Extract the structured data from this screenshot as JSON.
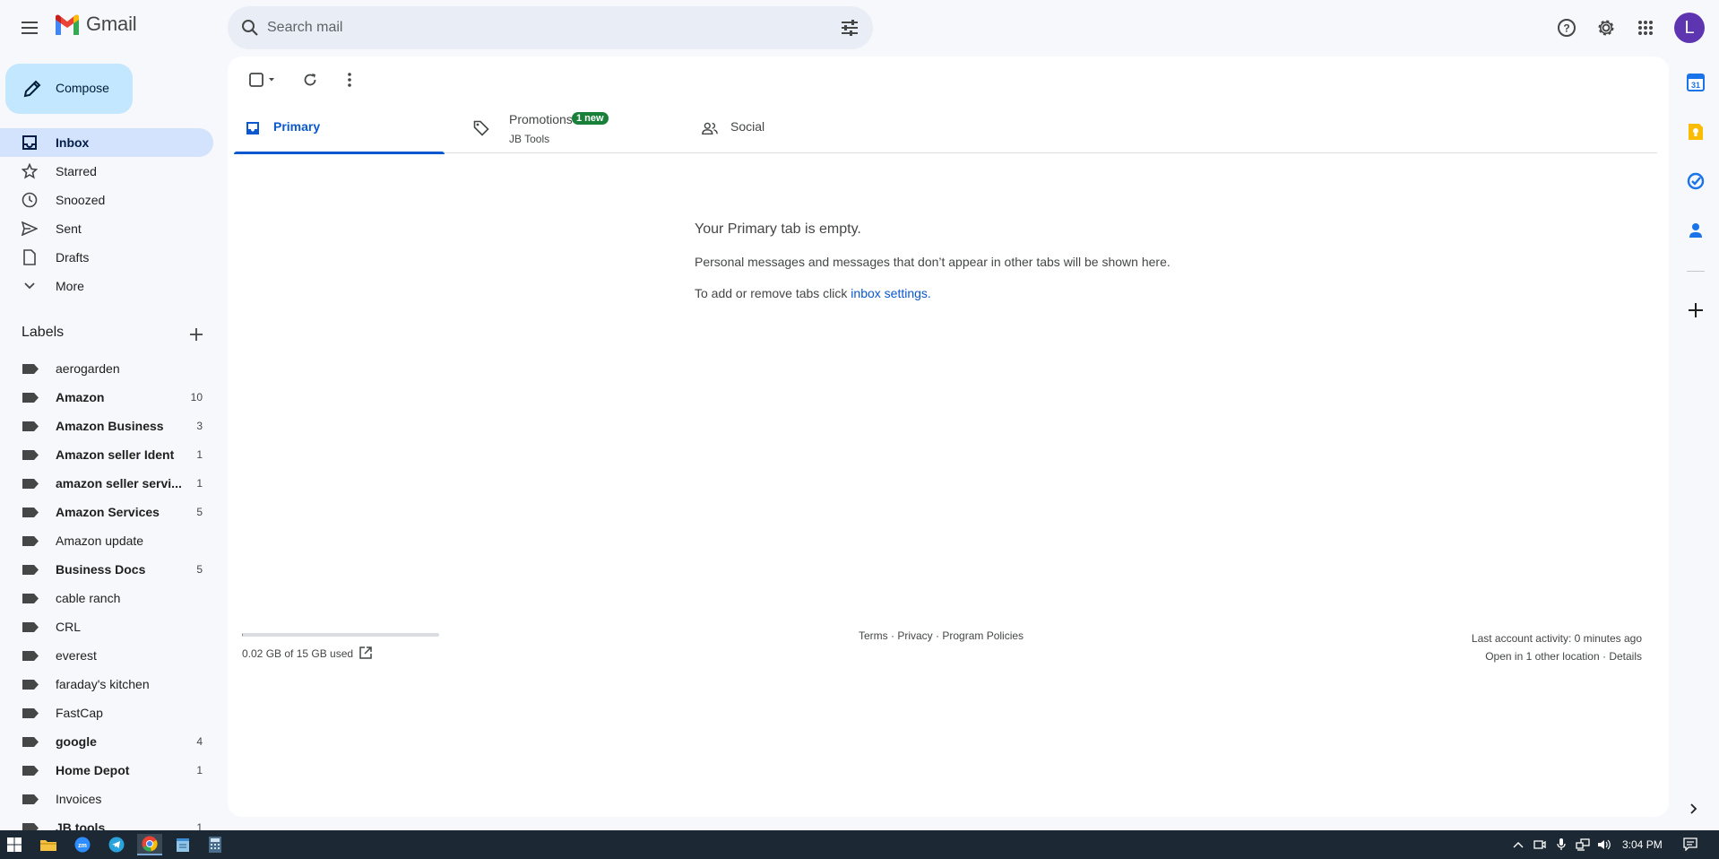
{
  "app": {
    "name": "Gmail",
    "brand_colors": {
      "red": "#ea4335",
      "blue": "#4285f4",
      "yellow": "#fbbc04",
      "green": "#34a853"
    }
  },
  "search": {
    "placeholder": "Search mail"
  },
  "header": {
    "avatar_letter": "L",
    "icons": [
      "help-icon",
      "settings-icon",
      "apps-grid-icon"
    ]
  },
  "compose": {
    "label": "Compose"
  },
  "nav": {
    "items": [
      {
        "label": "Inbox",
        "icon": "inbox-icon",
        "active": true
      },
      {
        "label": "Starred",
        "icon": "star-icon"
      },
      {
        "label": "Snoozed",
        "icon": "clock-icon"
      },
      {
        "label": "Sent",
        "icon": "send-icon"
      },
      {
        "label": "Drafts",
        "icon": "draft-icon"
      },
      {
        "label": "More",
        "icon": "chevron-down-icon"
      }
    ]
  },
  "labels": {
    "title": "Labels",
    "items": [
      {
        "name": "aerogarden",
        "count": "",
        "bold": false
      },
      {
        "name": "Amazon",
        "count": "10",
        "bold": true
      },
      {
        "name": "Amazon Business",
        "count": "3",
        "bold": true
      },
      {
        "name": "Amazon seller Ident",
        "count": "1",
        "bold": true
      },
      {
        "name": "amazon seller servi...",
        "count": "1",
        "bold": true
      },
      {
        "name": "Amazon Services",
        "count": "5",
        "bold": true
      },
      {
        "name": "Amazon update",
        "count": "",
        "bold": false
      },
      {
        "name": "Business Docs",
        "count": "5",
        "bold": true
      },
      {
        "name": "cable ranch",
        "count": "",
        "bold": false
      },
      {
        "name": "CRL",
        "count": "",
        "bold": false
      },
      {
        "name": "everest",
        "count": "",
        "bold": false
      },
      {
        "name": "faraday's kitchen",
        "count": "",
        "bold": false
      },
      {
        "name": "FastCap",
        "count": "",
        "bold": false
      },
      {
        "name": "google",
        "count": "4",
        "bold": true
      },
      {
        "name": "Home Depot",
        "count": "1",
        "bold": true
      },
      {
        "name": "Invoices",
        "count": "",
        "bold": false
      },
      {
        "name": "JB tools",
        "count": "1",
        "bold": true
      }
    ]
  },
  "tabs": [
    {
      "label": "Primary",
      "icon": "inbox-icon",
      "active": true,
      "sub": "",
      "badge": ""
    },
    {
      "label": "Promotions",
      "icon": "tag-icon",
      "active": false,
      "sub": "JB Tools",
      "badge": "1 new"
    },
    {
      "label": "Social",
      "icon": "people-icon",
      "active": false,
      "sub": "",
      "badge": ""
    }
  ],
  "empty_state": {
    "heading": "Your Primary tab is empty.",
    "line1": "Personal messages and messages that don’t appear in other tabs will be shown here.",
    "line2_prefix": "To add or remove tabs click ",
    "line2_link": "inbox settings",
    "line2_suffix": "."
  },
  "footer": {
    "storage": "0.02 GB of 15 GB used",
    "storage_fraction": 0.0013,
    "terms": "Terms",
    "privacy": "Privacy",
    "program_policies": "Program Policies",
    "separator": " · ",
    "last_activity": "Last account activity: 0 minutes ago",
    "open_other": "Open in 1 other location",
    "details": "Details"
  },
  "side_panel": {
    "icons": [
      "calendar-icon",
      "keep-icon",
      "tasks-icon",
      "contacts-icon",
      "add-addon-icon"
    ],
    "calendar_day": "31"
  },
  "taskbar": {
    "apps": [
      "start-icon",
      "file-explorer-icon",
      "zoom-icon",
      "telegram-icon",
      "chrome-icon",
      "notepad-icon",
      "calculator-icon"
    ],
    "zoom_label": "zm",
    "time": "3:04 PM"
  }
}
